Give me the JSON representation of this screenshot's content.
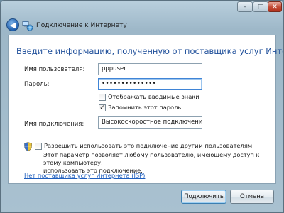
{
  "window": {
    "title": "Подключение к Интернету",
    "controls": {
      "minimize": "–",
      "maximize": "□",
      "close": "✕"
    },
    "back_glyph": "◀"
  },
  "main": {
    "heading": "Введите информацию, полученную от поставщика услуг Интернета",
    "username": {
      "label": "Имя пользователя:",
      "value": "pppuser"
    },
    "password": {
      "label": "Пароль:",
      "value": "••••••••••••••"
    },
    "show_chars": {
      "label": "Отображать вводимые знаки",
      "checked": false
    },
    "remember_password": {
      "label": "Запомнить этот пароль",
      "checked": true,
      "glyph": "✓"
    },
    "connection_name": {
      "label": "Имя подключения:",
      "value": "Высокоскоростное подключение"
    },
    "allow_others": {
      "label": "Разрешить использовать это подключение другим пользователям",
      "checked": false,
      "description_line1": "Этот параметр позволяет любому пользователю, имеющему доступ к этому компьютеру,",
      "description_line2": "использовать это подключение."
    },
    "isp_link": "Нет поставщика услуг Интернета (ISP)"
  },
  "buttons": {
    "connect": "Подключить",
    "cancel": "Отмена"
  },
  "colors": {
    "heading": "#1f4f9a",
    "link": "#1f5fbf",
    "frame": "#a9c1d0"
  }
}
